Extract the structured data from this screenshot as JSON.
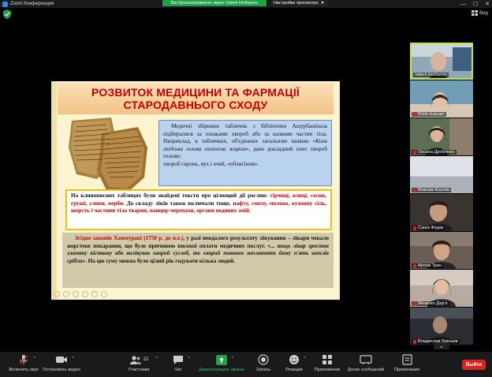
{
  "window": {
    "app_title": "Zoom Конференция",
    "share_banner": "Вы просматриваете экран Valerii Horbanov",
    "view_options_label": "Настройки просмотра",
    "view_button_label": "Вид"
  },
  "slide": {
    "title_line1": "РОЗВИТОК МЕДИЦИНИ ТА ФАРМАЦІЇ",
    "title_line2": "СТАРОДАВНЬОГО СХОДУ",
    "box1": {
      "p1": "Медичні збірники табличок з бібліотеки Ашурбаніпала підбиралися за ознаками хвороб або за назвами частин тіла. Наприклад, в табличках, об'єднаних загальною назвою «",
      "p1_italic": "Коли людська голова охоплена жаром",
      "p1_end": "», дано докладний опис хвороб голови:",
      "p2": "хвороб скронь, вух і очей, «облисіння»."
    },
    "box2": {
      "text1": "На клинописних таблицях були знайдені тексти про цілющий дії рослин: ",
      "red1": "гірчиці, ялиці, сосни, груші, сливи, верби.",
      "text2": " До складу ліків також включали тощо. ",
      "red2": "нафту, смолу, молоко, кухонну сіль, шерсть і частини тіла тварин, панцир черепахи, органи водяних змій."
    },
    "box3": {
      "red1": "Згідно законів Хаммурапі (1750 р. до н.е.)",
      "text1": ", у разі невдалого результату лікування – лікаря чекало жорстоке покарання, що було причиною високої оплати медичних послуг. «",
      "italic1": "... якщо лікар зростив зламану кісткову або вилікував хворий суглоб, то хворий повинен заплатити йому п'ять шеклів срібла",
      "text2": "». На цю суму можна було цілий рік годувати кілька людей."
    }
  },
  "participants": [
    {
      "name": "Valerii Horbanov",
      "muted": false,
      "active": true
    },
    {
      "name": "Юлія Ісаєнко",
      "muted": true,
      "active": false
    },
    {
      "name": "Оксана Дроблюко",
      "muted": true,
      "active": false
    },
    {
      "name": "Максим Козлов",
      "muted": true,
      "active": false
    },
    {
      "name": "Саша Федак",
      "muted": true,
      "active": false
    },
    {
      "name": "Артем Трач",
      "muted": true,
      "active": false
    },
    {
      "name": "Янченко Дар'я",
      "muted": true,
      "active": false
    },
    {
      "name": "Владислав Брінцев",
      "muted": true,
      "active": false
    }
  ],
  "toolbar": {
    "unmute": "Включить звук",
    "start_video": "Остановить видео",
    "participants": "Участники",
    "participants_count": "22",
    "chat": "Чат",
    "share_screen": "Демонстрация экрана",
    "record": "Запись",
    "reactions": "Реакции",
    "apps": "Приложения",
    "whiteboards": "Доски сообщений",
    "notes": "Примечания",
    "end": "Выйти"
  },
  "colors": {
    "share_green": "#23a04b",
    "end_red": "#d6251e",
    "active_speaker": "#c8e63a",
    "slide_title_red": "#c00000"
  }
}
